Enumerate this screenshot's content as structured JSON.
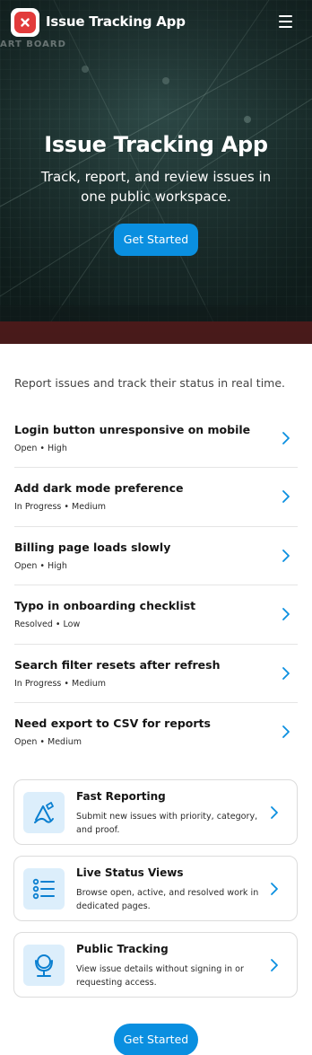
{
  "header": {
    "brand": "Issue Tracking App",
    "watermark": "ART BOARD"
  },
  "hero": {
    "title": "Issue Tracking App",
    "subtitle": "Track, report, and review issues in one public workspace.",
    "cta_label": "Get Started"
  },
  "main": {
    "intro": "Report issues and track their status in real time.",
    "issues": [
      {
        "title": "Login button unresponsive on mobile",
        "meta": "Open • High"
      },
      {
        "title": "Add dark mode preference",
        "meta": "In Progress • Medium"
      },
      {
        "title": "Billing page loads slowly",
        "meta": "Open • High"
      },
      {
        "title": "Typo in onboarding checklist",
        "meta": "Resolved • Low"
      },
      {
        "title": "Search filter resets after refresh",
        "meta": "In Progress • Medium"
      },
      {
        "title": "Need export to CSV for reports",
        "meta": "Open • Medium"
      }
    ],
    "features": [
      {
        "title": "Fast Reporting",
        "description": "Submit new issues with priority, category, and proof.",
        "icon": "pen-tool-icon"
      },
      {
        "title": "Live Status Views",
        "description": "Browse open, active, and resolved work in dedicated pages.",
        "icon": "list-icon"
      },
      {
        "title": "Public Tracking",
        "description": "View issue details without signing in or requesting access.",
        "icon": "globe-stand-icon"
      }
    ],
    "bottom_cta_label": "Get Started"
  },
  "colors": {
    "accent": "#0a8fe0",
    "logo_red": "#e23b3b",
    "icon_bg": "#dceefb"
  }
}
